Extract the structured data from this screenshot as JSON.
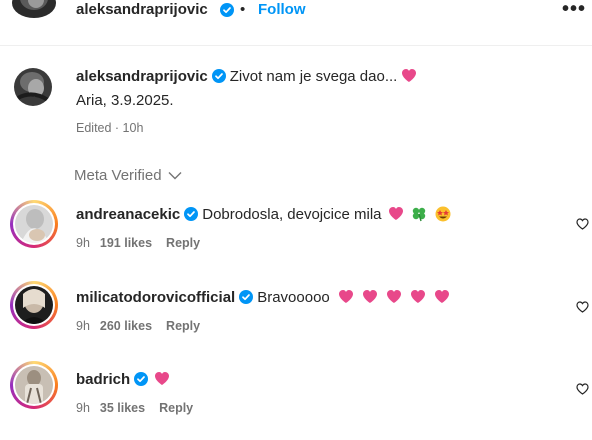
{
  "header": {
    "username": "aleksandraprijovic",
    "separator": "•",
    "follow_label": "Follow",
    "more_label": "•••"
  },
  "caption": {
    "username": "aleksandraprijovic",
    "text": "Zivot nam je svega dao...",
    "line2": "Aria, 3.9.2025.",
    "meta": "Edited · 10h"
  },
  "meta_verified_label": "Meta Verified",
  "comments": [
    {
      "username": "andreanacekic",
      "text": "Dobrodosla, devojcice mila",
      "time": "9h",
      "likes": "191 likes",
      "reply": "Reply",
      "emojis": [
        "heart",
        "four-leaf-clover",
        "star-struck"
      ]
    },
    {
      "username": "milicatodorovicofficial",
      "text": "Bravooooo",
      "time": "9h",
      "likes": "260 likes",
      "reply": "Reply",
      "emojis": [
        "heart",
        "heart",
        "heart",
        "heart",
        "heart"
      ]
    },
    {
      "username": "badrich",
      "text": "",
      "time": "9h",
      "likes": "35 likes",
      "reply": "Reply",
      "emojis": [
        "heart"
      ]
    }
  ],
  "colors": {
    "text": "#262626",
    "secondary": "#737373",
    "link": "#0095f6",
    "verified": "#0095f6",
    "heart": "#ff3b6a",
    "story_ring_start": "#feda75",
    "story_ring_end": "#d62976"
  }
}
